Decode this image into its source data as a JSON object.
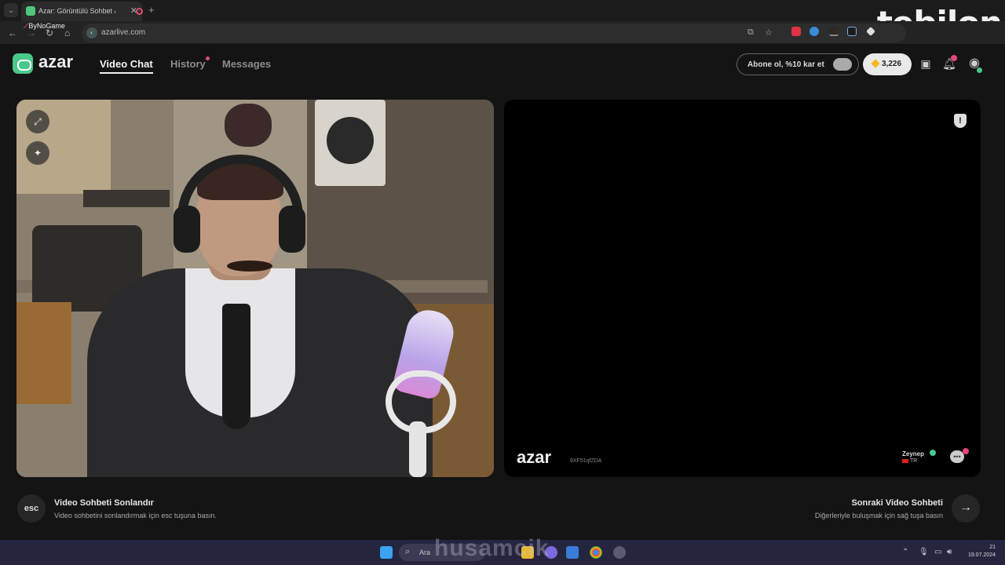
{
  "browser": {
    "tab_title": "Azar: Görüntülü Sohbet & Y",
    "url": "azarlive.com",
    "bookmark_label": "ByNoGame",
    "watermark_text": "tebilon"
  },
  "app": {
    "logo_text": "azar",
    "nav": [
      "Video Chat",
      "History",
      "Messages"
    ],
    "promo_label": "Abone ol, %10 kar et",
    "coin_balance": "3,226",
    "notification_count": "1",
    "accent_color": "#4ac88a",
    "badge_color": "#e8457e"
  },
  "remote": {
    "logo_text": "azar",
    "session_id": "8XF51qfZDA",
    "partner_name": "Zeynep",
    "partner_country": "TR",
    "unread_count": "1"
  },
  "controls": {
    "esc_key_label": "esc",
    "end_title": "Video Sohbeti Sonlandır",
    "end_subtitle": "Video sohbetini sonlandırmak için esc tuşuna basın.",
    "next_title": "Sonraki Video Sohbeti",
    "next_subtitle": "Diğerleriyle buluşmak için sağ tuşa basın"
  },
  "taskbar": {
    "search_label": "Ara",
    "overlay_text": "husamcik",
    "clock_time": "21",
    "clock_date": "19.07.2024"
  }
}
